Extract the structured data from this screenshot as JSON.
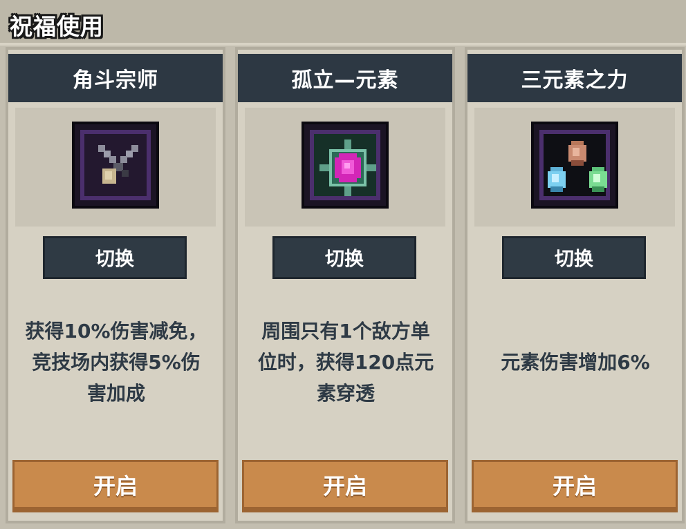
{
  "header": {
    "title": "祝福使用"
  },
  "cards": [
    {
      "title": "角斗宗师",
      "icon": "crossed-swords-icon",
      "switch_label": "切换",
      "desc_lines": [
        "获得10%伤害减免，",
        "竞技场内获得5%伤",
        "害加成"
      ],
      "open_label": "开启"
    },
    {
      "title": "孤立—元素",
      "icon": "magenta-gem-icon",
      "switch_label": "切换",
      "desc_lines": [
        "周围只有1个敌方单",
        "位时，获得120点元",
        "素穿透"
      ],
      "open_label": "开启"
    },
    {
      "title": "三元素之力",
      "icon": "three-elements-icon",
      "switch_label": "切换",
      "desc_lines": [
        "元素伤害增加6%"
      ],
      "open_label": "开启"
    }
  ],
  "colors": {
    "header_bg": "#bdb8a9",
    "card_bg": "#d6d1c3",
    "title_bar": "#2d3843",
    "switch_button": "#2f3a44",
    "open_button": "#c98a4c",
    "desc_text": "#2e3a45"
  }
}
